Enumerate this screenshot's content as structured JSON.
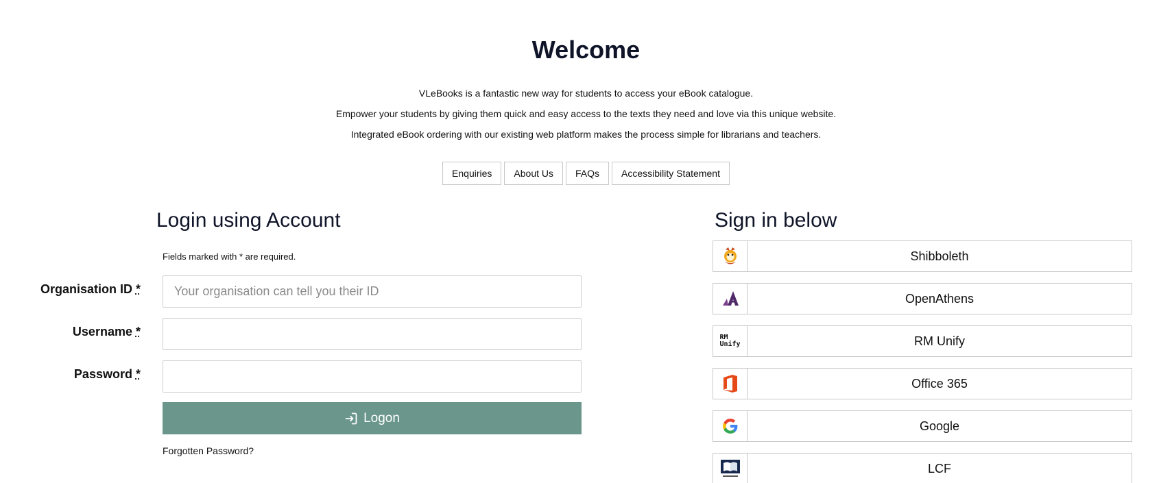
{
  "welcome": {
    "title": "Welcome",
    "lines": [
      "VLeBooks is a fantastic new way for students to access your eBook catalogue.",
      "Empower your students by giving them quick and easy access to the texts they need and love via this unique website.",
      "Integrated eBook ordering with our existing web platform makes the process simple for librarians and teachers."
    ]
  },
  "nav": {
    "items": [
      "Enquiries",
      "About Us",
      "FAQs",
      "Accessibility Statement"
    ]
  },
  "login": {
    "heading": "Login using Account",
    "required_note": "Fields marked with * are required.",
    "required_marker": "*",
    "fields": [
      {
        "label": "Organisation ID",
        "placeholder": "Your organisation can tell you their ID",
        "value": ""
      },
      {
        "label": "Username",
        "placeholder": "",
        "value": ""
      },
      {
        "label": "Password",
        "placeholder": "",
        "value": ""
      }
    ],
    "logon_label": "Logon",
    "forgot_label": "Forgotten Password?",
    "accent_color": "#6a968c"
  },
  "signin": {
    "heading": "Sign in below",
    "providers": [
      {
        "name": "Shibboleth",
        "icon": "shibboleth-logo-icon"
      },
      {
        "name": "OpenAthens",
        "icon": "openathens-logo-icon"
      },
      {
        "name": "RM Unify",
        "icon": "rm-unify-logo-icon",
        "logo_text_top": "RM",
        "logo_text_bottom": "Unify"
      },
      {
        "name": "Office 365",
        "icon": "office365-logo-icon"
      },
      {
        "name": "Google",
        "icon": "google-logo-icon"
      },
      {
        "name": "LCF",
        "icon": "lcf-logo-icon"
      }
    ]
  }
}
